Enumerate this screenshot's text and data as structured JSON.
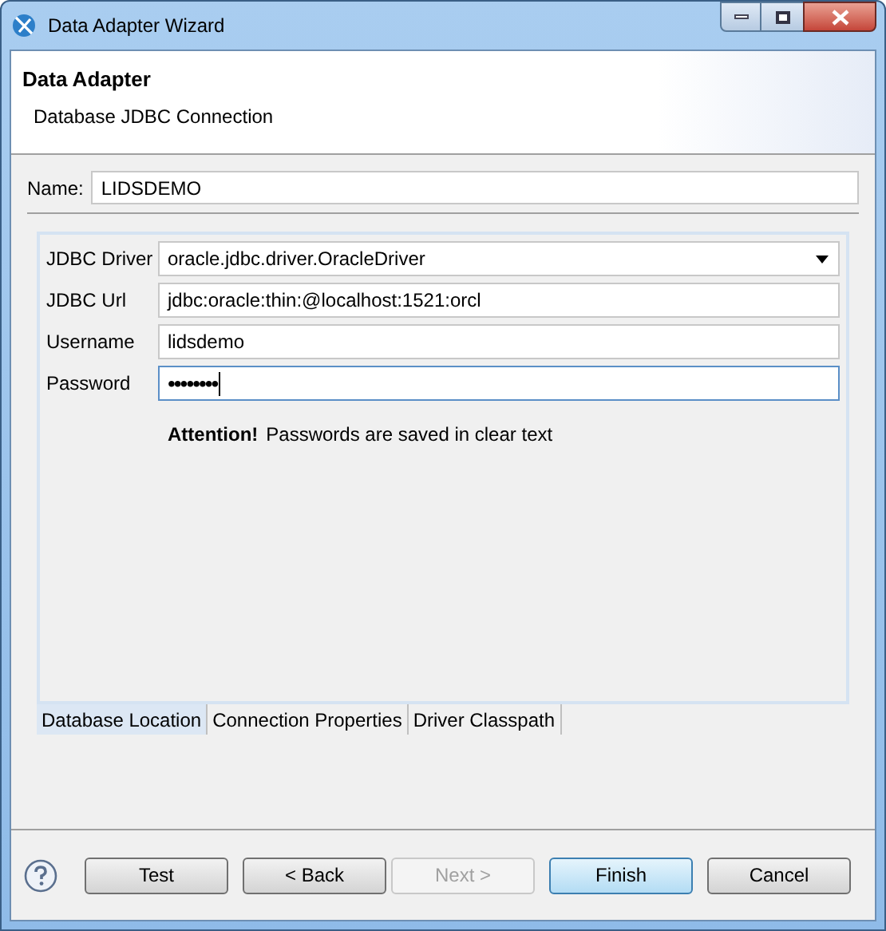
{
  "window": {
    "title": "Data Adapter Wizard"
  },
  "header": {
    "title": "Data Adapter",
    "description": "Database JDBC Connection"
  },
  "name_field": {
    "label": "Name:",
    "value": "LIDSDEMO"
  },
  "fields": [
    {
      "kind": "dropdown",
      "label": "JDBC Driver",
      "value": "oracle.jdbc.driver.OracleDriver",
      "focused": false
    },
    {
      "kind": "text",
      "label": "JDBC Url",
      "value": "jdbc:oracle:thin:@localhost:1521:orcl",
      "focused": false
    },
    {
      "kind": "text",
      "label": "Username",
      "value": "lidsdemo",
      "focused": false
    },
    {
      "kind": "password",
      "label": "Password",
      "value": "••••••••",
      "focused": true
    }
  ],
  "notice": {
    "title": "Attention!",
    "text": "Passwords are saved in clear text"
  },
  "tabs": [
    {
      "label": "Database Location",
      "selected": true
    },
    {
      "label": "Connection Properties",
      "selected": false
    },
    {
      "label": "Driver Classpath",
      "selected": false
    }
  ],
  "buttons": [
    {
      "label": "Test",
      "disabled": false,
      "default": false
    },
    {
      "label": "< Back",
      "disabled": false,
      "default": false
    },
    {
      "label": "Next >",
      "disabled": true,
      "default": false
    },
    {
      "label": "Finish",
      "disabled": false,
      "default": true
    },
    {
      "label": "Cancel",
      "disabled": false,
      "default": false
    }
  ]
}
